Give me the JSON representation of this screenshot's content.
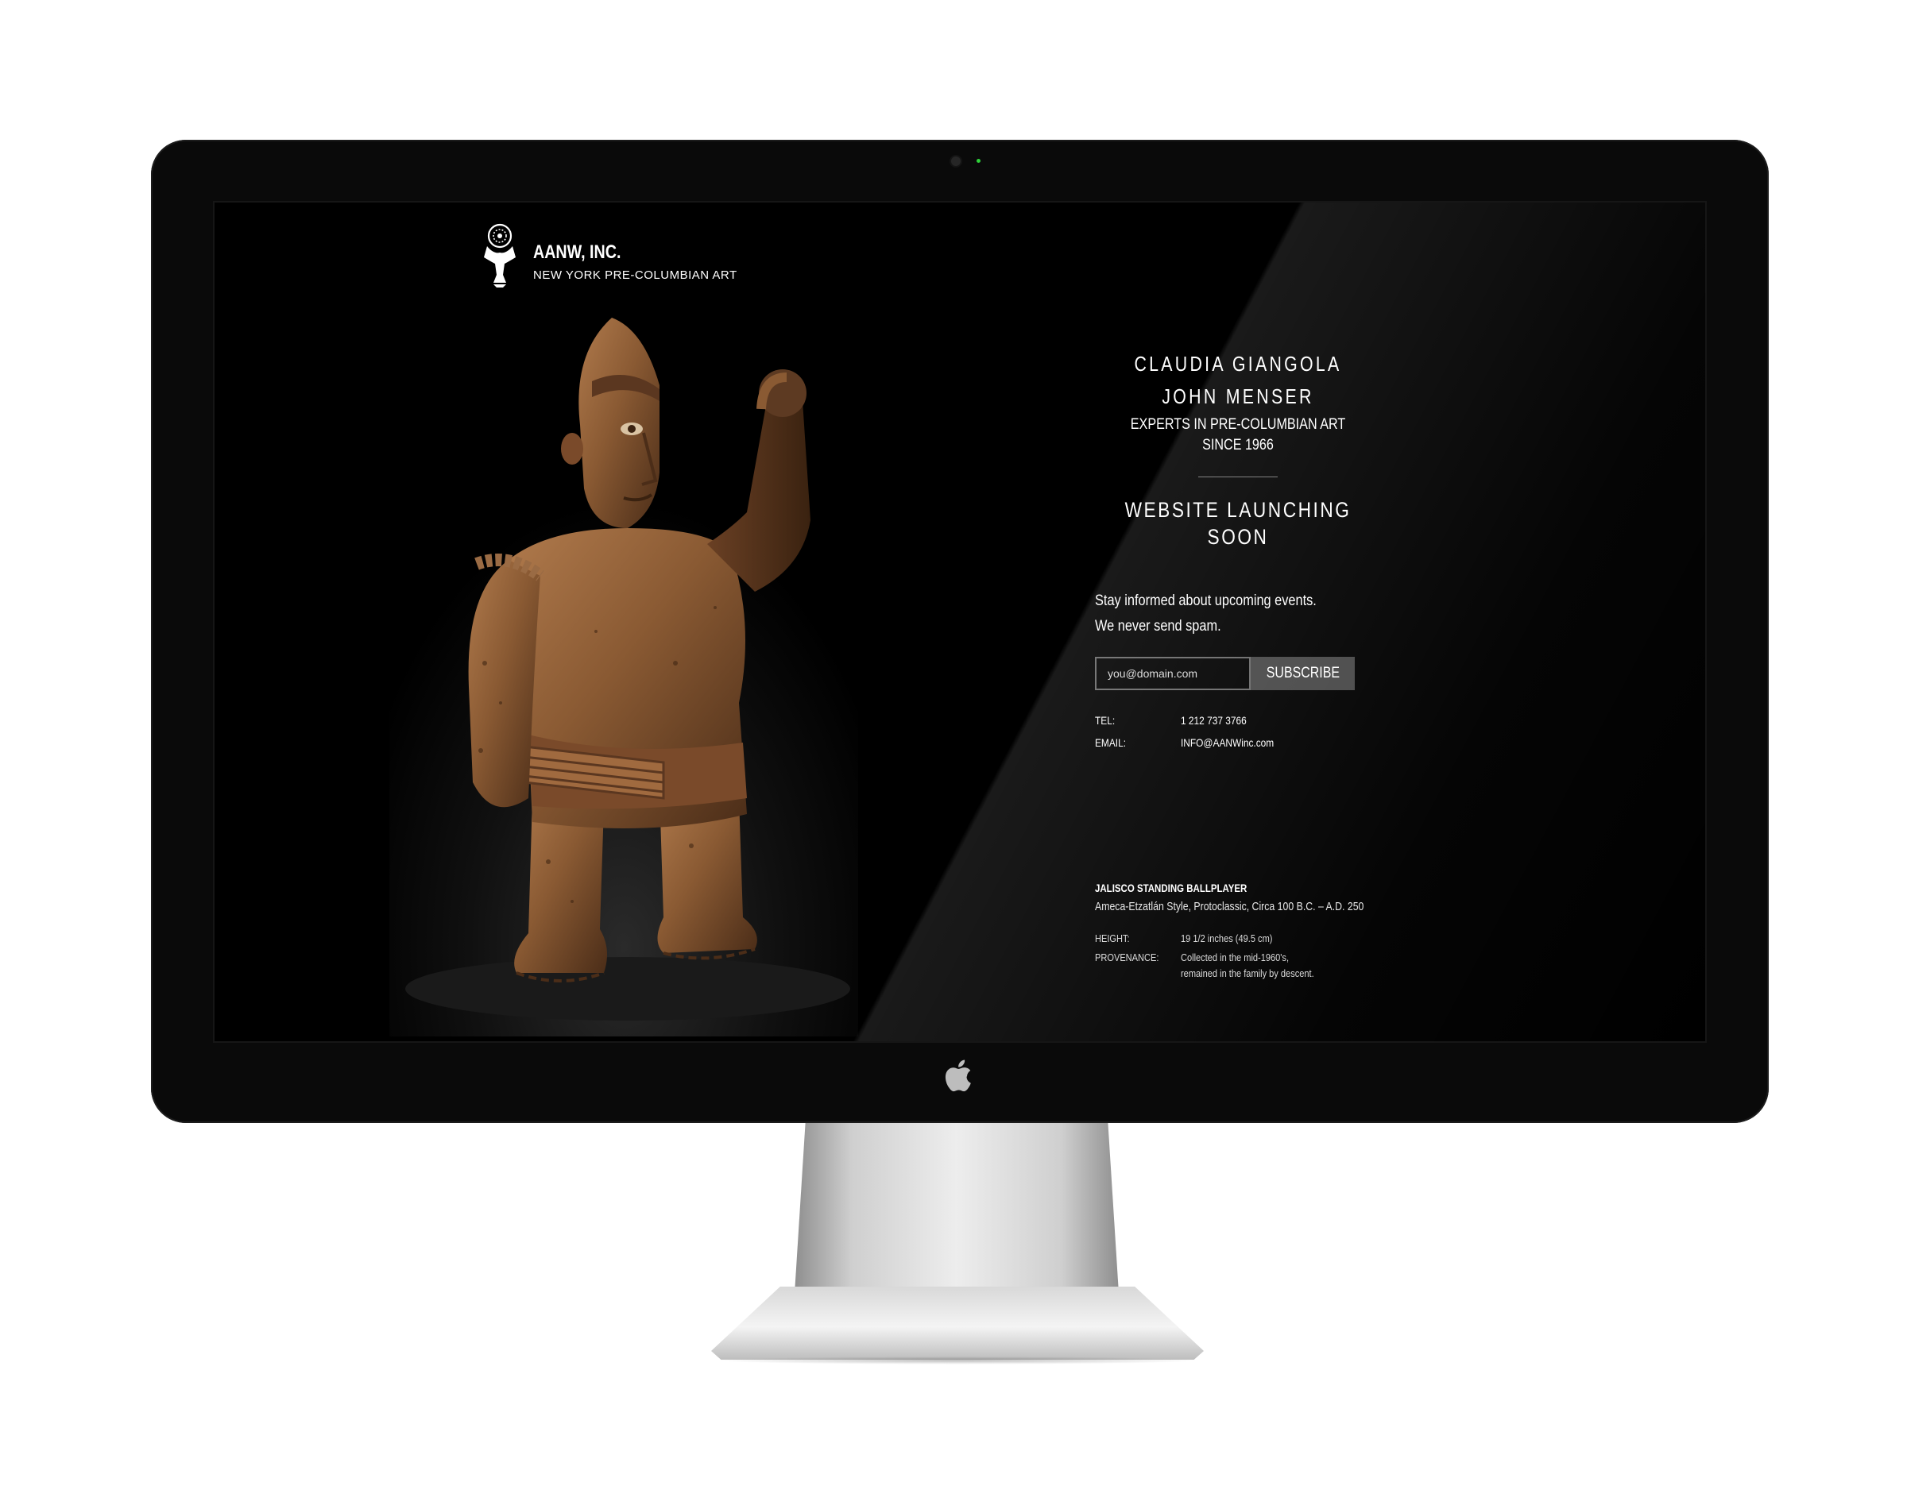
{
  "brand": {
    "name": "AANW, INC.",
    "tagline": "NEW YORK PRE-COLUMBIAN ART"
  },
  "intro": {
    "names": [
      "CLAUDIA GIANGOLA",
      "JOHN MENSER"
    ],
    "tagline": "EXPERTS IN PRE-COLUMBIAN ART SINCE 1966",
    "launch": "WEBSITE LAUNCHING SOON"
  },
  "signup": {
    "line1": "Stay informed about upcoming events.",
    "line2": "We never send spam.",
    "email_placeholder": "you@domain.com",
    "subscribe_label": "SUBSCRIBE"
  },
  "contact": {
    "tel_label": "TEL:",
    "tel_value": "1 212 737 3766",
    "email_label": "EMAIL:",
    "email_value": "INFO@AANWinc.com"
  },
  "artwork": {
    "title": "JALISCO STANDING BALLPLAYER",
    "subtitle": "Ameca-Etzatlán Style, Protoclassic, Circa 100 B.C. – A.D. 250",
    "height_label": "HEIGHT:",
    "height_value": "19 1/2 inches (49.5 cm)",
    "provenance_label": "PROVENANCE:",
    "provenance_line1": "Collected in the mid-1960's,",
    "provenance_line2": "remained in the family by descent."
  },
  "icons": {
    "brand_mark": "bird-figure-logo-icon",
    "hardware_logo": "apple-logo-icon"
  },
  "colors": {
    "screen_bg": "#000000",
    "bezel": "#0a0a0a",
    "button_bg": "#484848",
    "text": "#ffffff",
    "statue_clay": "#8a5a33"
  }
}
